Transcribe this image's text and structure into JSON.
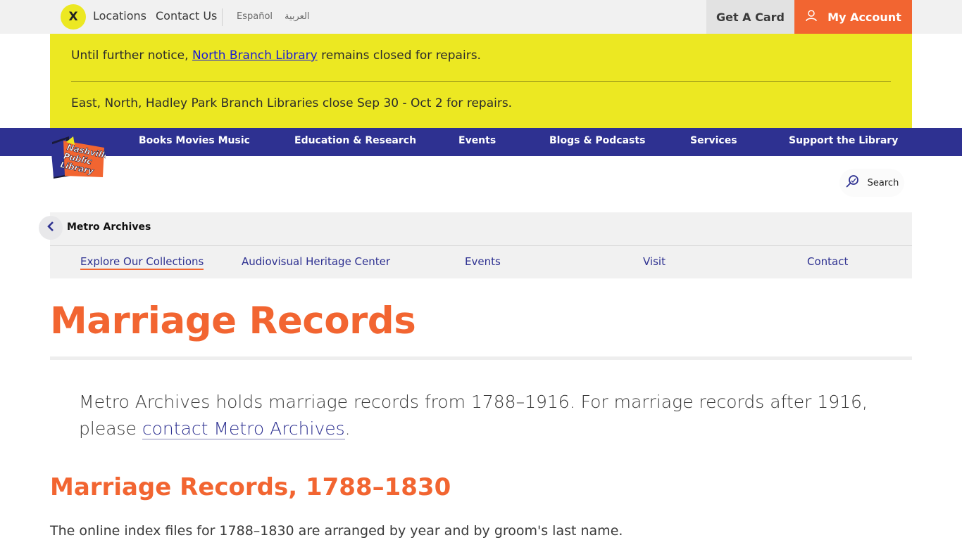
{
  "topbar": {
    "close_label": "X",
    "locations": "Locations",
    "contact_us": "Contact Us",
    "lang_es": "Español",
    "lang_ar": "العربية",
    "get_card": "Get A Card",
    "my_account": "My Account"
  },
  "alert": {
    "line1_before": "Until further notice, ",
    "line1_link": "North Branch Library",
    "line1_after": " remains closed for repairs.",
    "line2": "East, North, Hadley Park Branch Libraries close Sep 30 - Oct 2 for repairs."
  },
  "nav": {
    "items": [
      "Books Movies Music",
      "Education & Research",
      "Events",
      "Blogs & Podcasts",
      "Services",
      "Support the Library"
    ]
  },
  "logo": {
    "lines": [
      "Nashville",
      "Public",
      "Library"
    ]
  },
  "search": {
    "label": "Search"
  },
  "section": {
    "title": "Metro Archives",
    "links": [
      "Explore Our Collections",
      "Audiovisual Heritage Center",
      "Events",
      "Visit",
      "Contact"
    ]
  },
  "content": {
    "title": "Marriage Records",
    "intro_before": "Metro Archives holds marriage records from 1788–1916. For marriage records after 1916, please ",
    "intro_link": "contact Metro Archives",
    "intro_after": ".",
    "h2": "Marriage Records, 1788–1830",
    "body": "The online index files for 1788–1830 are arranged by year and by groom's last name."
  },
  "colors": {
    "accent_orange": "#f26531",
    "nav_blue": "#2e3191",
    "alert_yellow": "#ece822"
  }
}
